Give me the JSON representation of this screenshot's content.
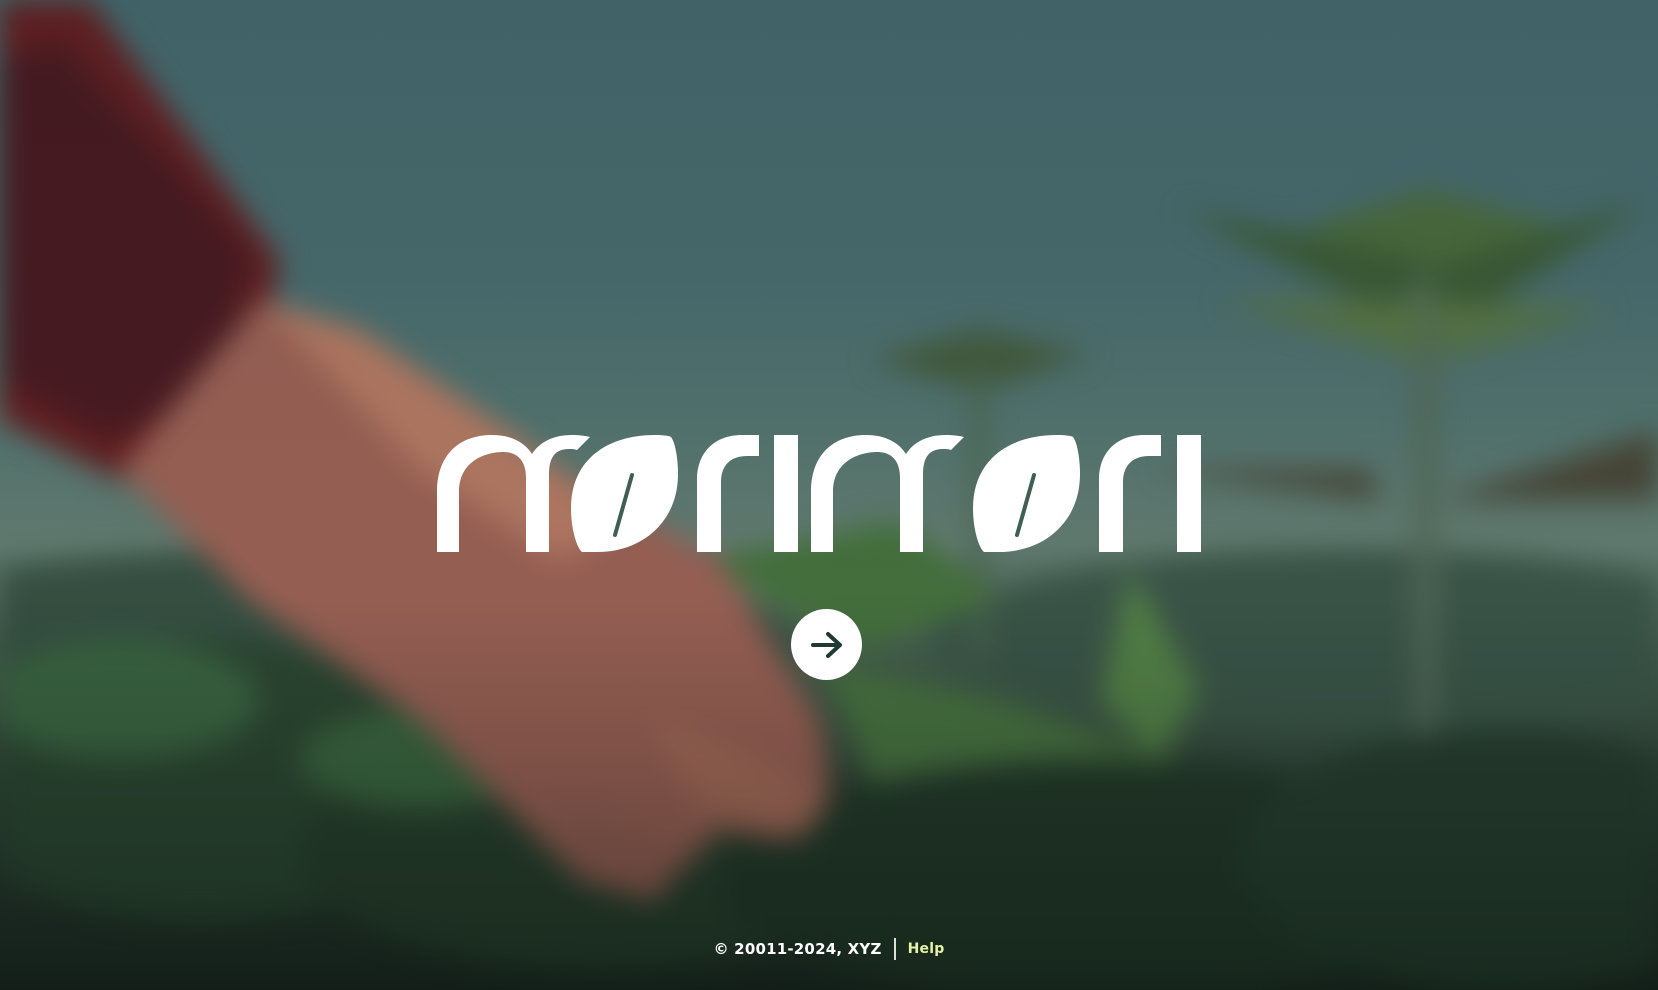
{
  "brand": {
    "logo_text": "morimori"
  },
  "enter_button": {
    "icon": "arrow-right-icon"
  },
  "footer": {
    "copyright": "© 20011-2024, XYZ",
    "help_label": "Help"
  },
  "colors": {
    "logo": "#ffffff",
    "button_bg": "#ffffff",
    "button_icon": "#1f3a32",
    "help_link": "#e6f2a6"
  }
}
